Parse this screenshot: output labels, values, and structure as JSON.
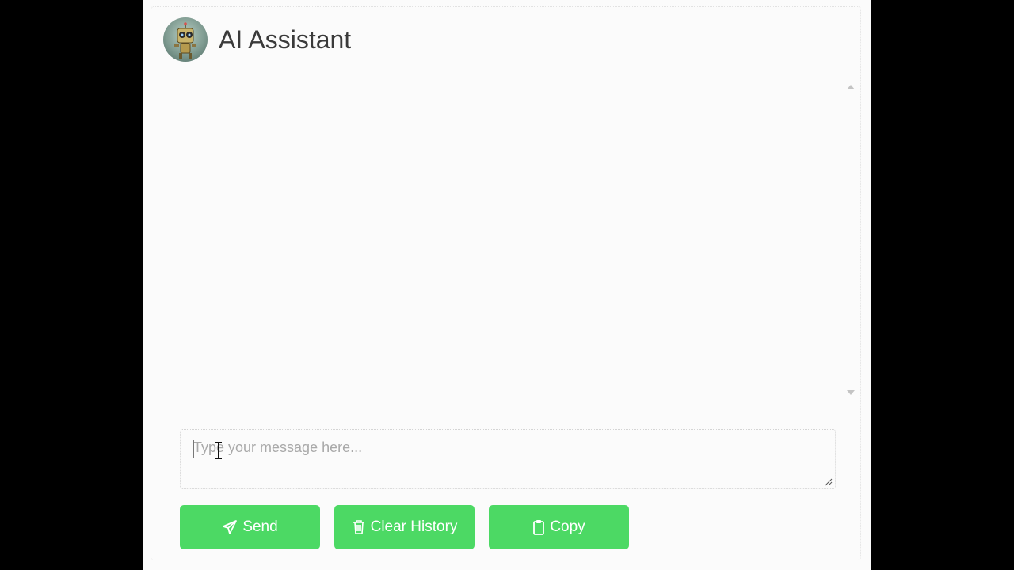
{
  "header": {
    "title": "AI Assistant",
    "avatar_icon": "robot-avatar-icon"
  },
  "composer": {
    "placeholder": "Type your message here...",
    "value": ""
  },
  "actions": {
    "send_label": "Send",
    "clear_label": "Clear History",
    "copy_label": "Copy",
    "send_icon": "paper-plane-icon",
    "clear_icon": "trash-icon",
    "copy_icon": "clipboard-icon"
  },
  "colors": {
    "button_bg": "#4cd964",
    "button_text": "#ffffff",
    "page_bg": "#fbfbfb",
    "backdrop": "#000000"
  }
}
